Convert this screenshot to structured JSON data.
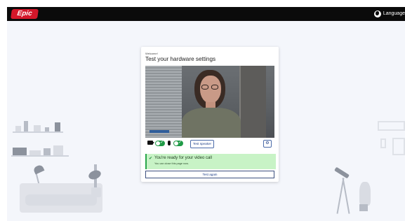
{
  "header": {
    "logo_text": "Epic",
    "language_label": "Language"
  },
  "card": {
    "welcome_text": "Welcome!",
    "title": "Test your hardware settings",
    "controls": {
      "test_speaker_label": "Test speaker",
      "camera_enabled": true,
      "microphone_enabled": true
    },
    "ready": {
      "title": "You're ready for your video call",
      "subtitle": "You can close this page now."
    },
    "test_again_label": "Test again"
  },
  "colors": {
    "topbar": "#0b0b0b",
    "logo": "#d4172a",
    "background": "#f4f6fb",
    "ready_bg": "#c8f3c6",
    "toggle_on": "#1f9a46",
    "link_blue": "#1e3f88"
  }
}
